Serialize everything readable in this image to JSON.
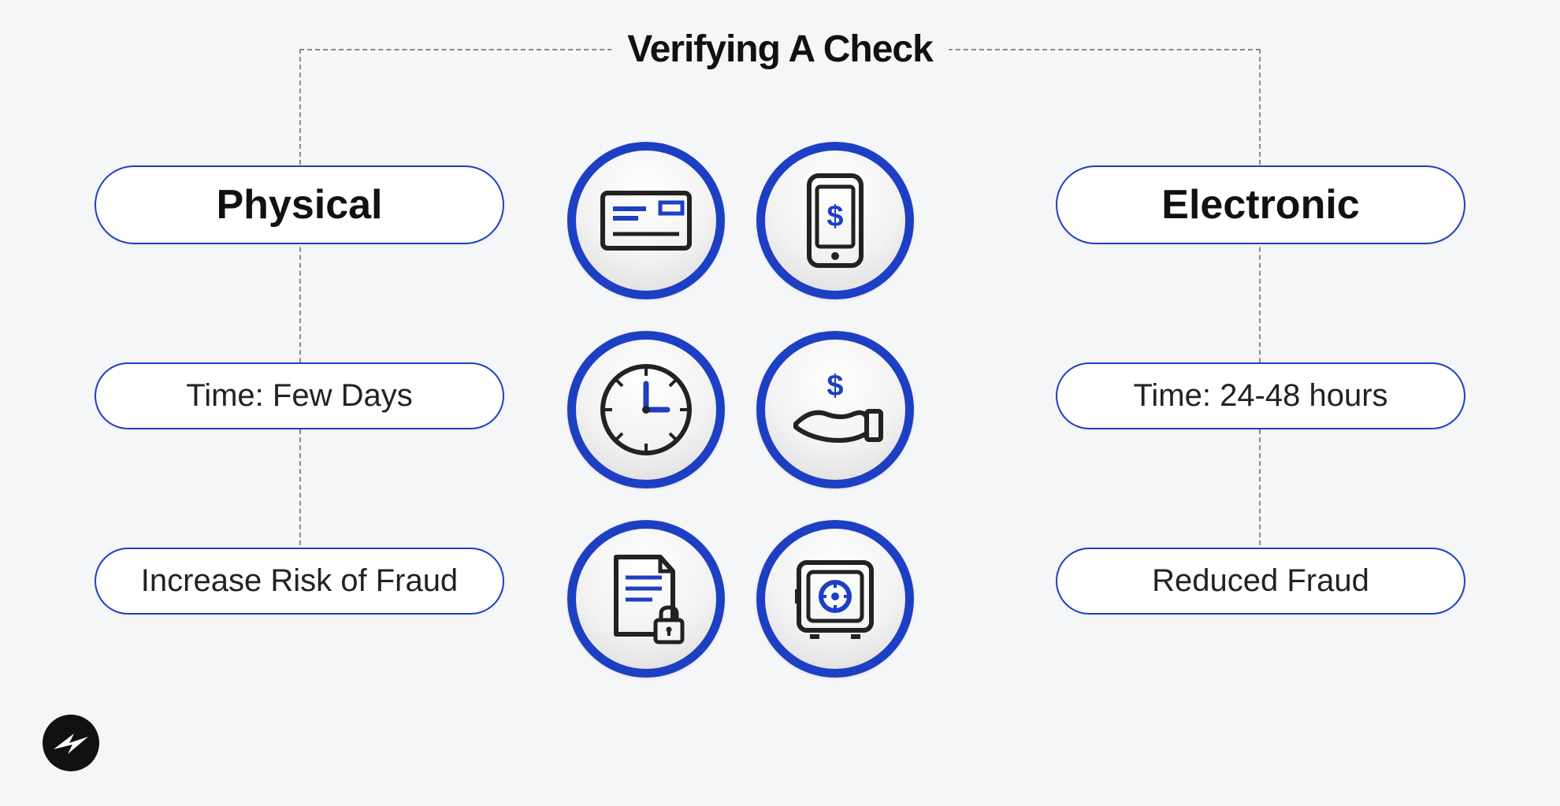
{
  "title": "Verifying A Check",
  "left": {
    "header": "Physical",
    "time": "Time: Few Days",
    "fraud": "Increase Risk of Fraud"
  },
  "right": {
    "header": "Electronic",
    "time": "Time: 24-48 hours",
    "fraud": "Reduced Fraud"
  },
  "icons": {
    "check": "check-icon",
    "phone": "phone-dollar-icon",
    "clock": "clock-icon",
    "hand": "hand-dollar-icon",
    "doc": "document-lock-icon",
    "safe": "safe-icon"
  }
}
